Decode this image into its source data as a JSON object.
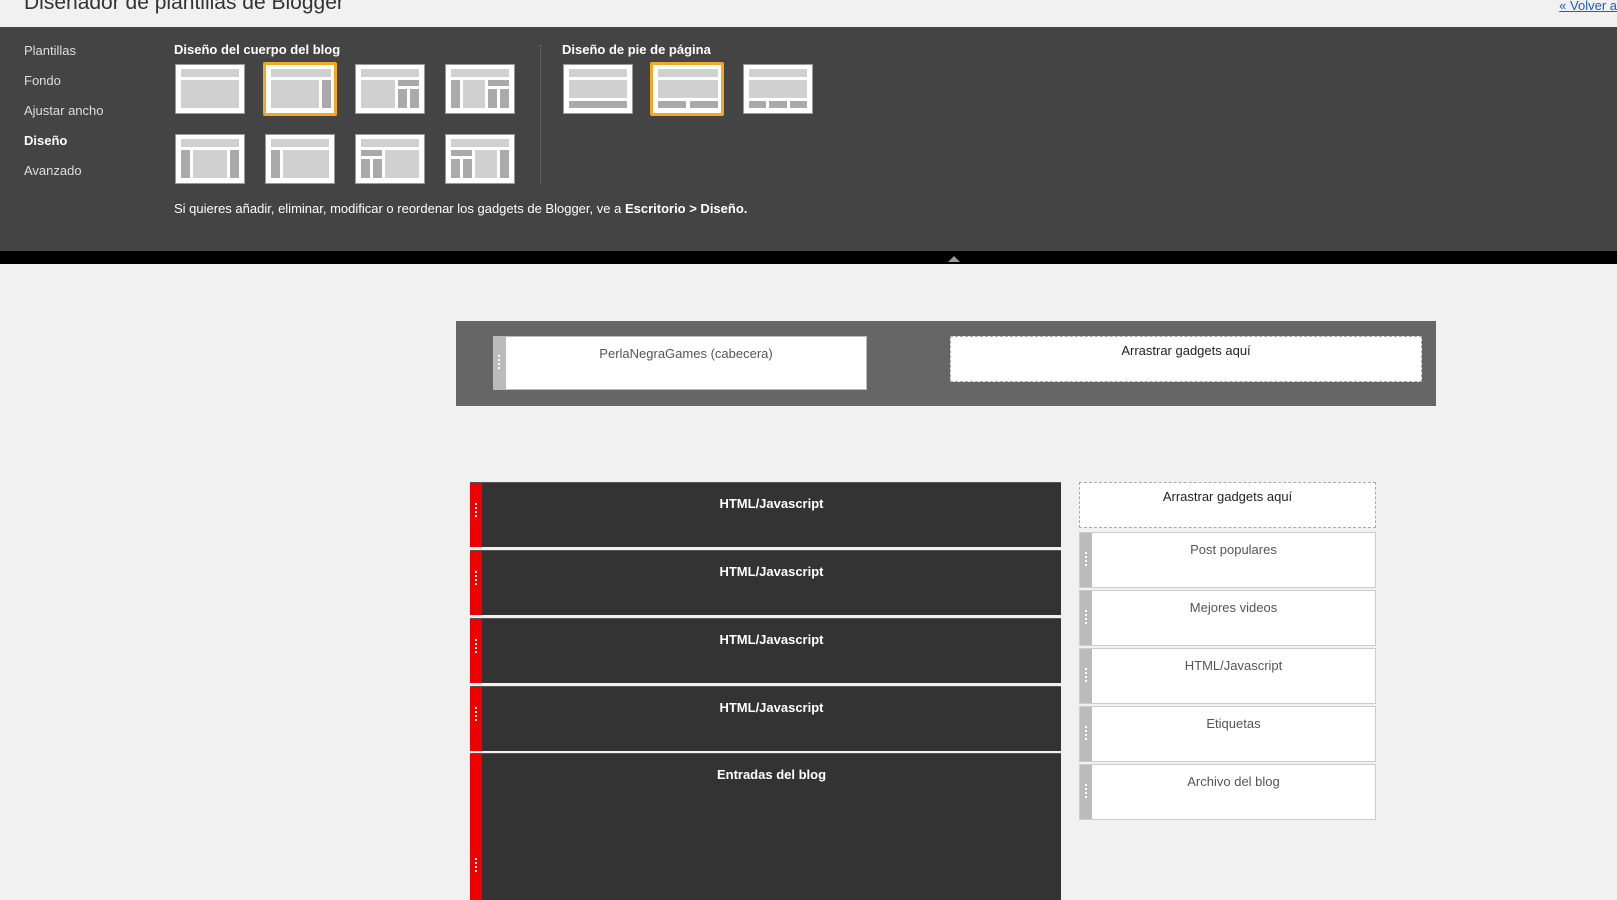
{
  "header": {
    "title": "Diseñador de plantillas de Blogger",
    "back_link": "« Volver a"
  },
  "nav": {
    "items": [
      {
        "label": "Plantillas"
      },
      {
        "label": "Fondo"
      },
      {
        "label": "Ajustar ancho"
      },
      {
        "label": "Diseño",
        "active": true
      },
      {
        "label": "Avanzado"
      }
    ]
  },
  "body_layouts": {
    "title": "Diseño del cuerpo del blog",
    "selected_index": 1
  },
  "footer_layouts": {
    "title": "Diseño de pie de página",
    "selected_index": 1
  },
  "note": {
    "text": "Si quieres añadir, eliminar, modificar o reordenar los gadgets de Blogger, ve a ",
    "link": "Escritorio > Diseño."
  },
  "canvas": {
    "header_gadget": "PerlaNegraGames (cabecera)",
    "drop_label": "Arrastrar gadgets aquí",
    "main_gadgets": [
      "HTML/Javascript",
      "HTML/Javascript",
      "HTML/Javascript",
      "HTML/Javascript",
      "Entradas del blog"
    ],
    "sidebar_drop_label": "Arrastrar gadgets aquí",
    "sidebar_gadgets": [
      "Post populares",
      "Mejores videos",
      "HTML/Javascript",
      "Etiquetas",
      "Archivo del blog"
    ]
  },
  "colors": {
    "panel": "#444444",
    "selected_border": "#f5a623",
    "main_gadget_grip": "#e00000",
    "main_gadget_bg": "#333333"
  }
}
